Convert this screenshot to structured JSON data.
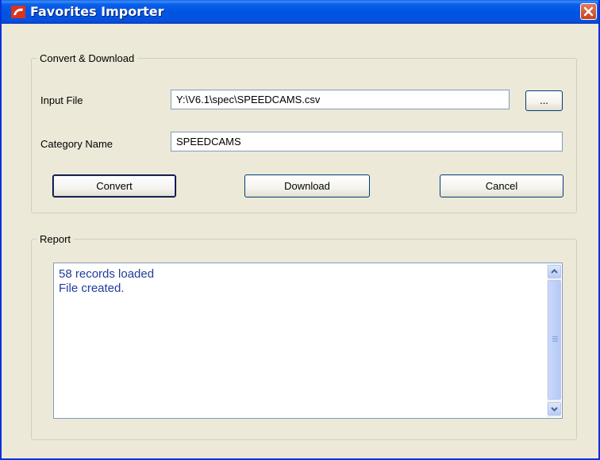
{
  "window": {
    "title": "Favorites Importer"
  },
  "convert_group": {
    "legend": "Convert & Download",
    "input_file_label": "Input File",
    "input_file_value": "Y:\\V6.1\\spec\\SPEEDCAMS.csv",
    "browse_label": "...",
    "category_label": "Category Name",
    "category_value": "SPEEDCAMS",
    "convert_label": "Convert",
    "download_label": "Download",
    "cancel_label": "Cancel"
  },
  "report_group": {
    "legend": "Report",
    "lines": [
      "58 records loaded",
      "File created."
    ]
  },
  "colors": {
    "title_bar": "#0054e3",
    "report_text": "#1f3d9c",
    "close_button": "#c8401f"
  }
}
